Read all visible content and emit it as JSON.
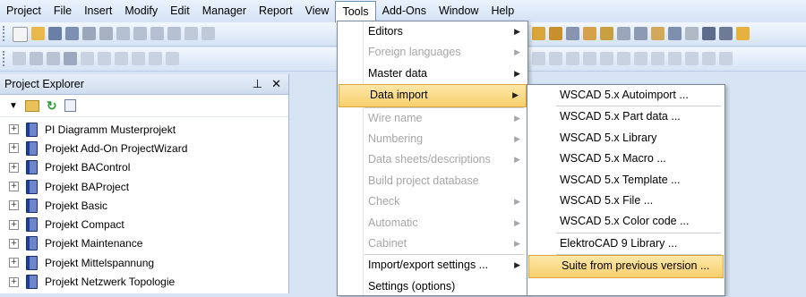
{
  "menubar": {
    "items": [
      "Project",
      "File",
      "Insert",
      "Modify",
      "Edit",
      "Manager",
      "Report",
      "View",
      "Tools",
      "Add-Ons",
      "Window",
      "Help"
    ]
  },
  "explorer": {
    "title": "Project Explorer",
    "projects": [
      "PI Diagramm Musterprojekt",
      "Projekt Add-On ProjectWizard",
      "Projekt BAControl",
      "Projekt BAProject",
      "Projekt Basic",
      "Projekt Compact",
      "Projekt Maintenance",
      "Projekt Mittelspannung",
      "Projekt Netzwerk Topologie"
    ]
  },
  "tools_menu": {
    "items": [
      "Editors",
      "Foreign languages",
      "Master data",
      "Data import",
      "Wire name",
      "Numbering",
      "Data sheets/descriptions",
      "Build project database",
      "Check",
      "Automatic",
      "Cabinet",
      "Import/export settings ...",
      "Settings (options)"
    ]
  },
  "data_import_menu": {
    "items": [
      "WSCAD 5.x Autoimport ...",
      "WSCAD 5.x Part data ...",
      "WSCAD 5.x Library",
      "WSCAD 5.x Macro ...",
      "WSCAD 5.x Template ...",
      "WSCAD 5.x File ...",
      "WSCAD 5.x Color code ...",
      "ElektroCAD 9 Library ...",
      "Suite from previous version ..."
    ]
  }
}
